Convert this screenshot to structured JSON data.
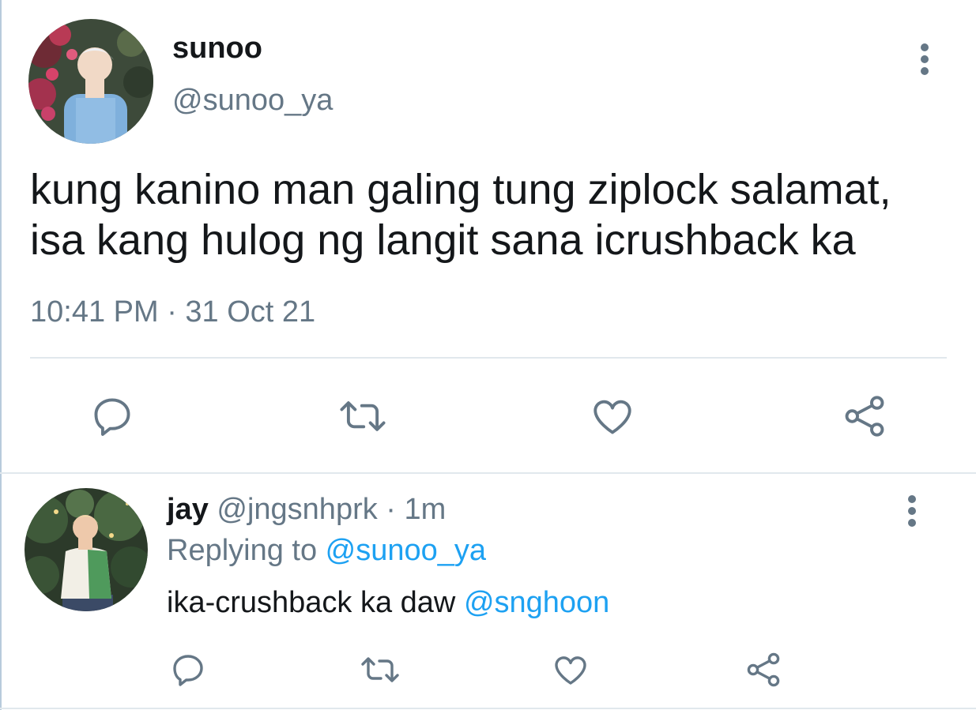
{
  "main_tweet": {
    "display_name": "sunoo",
    "handle": "@sunoo_ya",
    "text_line_1": "kung kanino man galing tung ziplock salamat,",
    "text_line_2": "isa kang hulog ng langit sana icrushback ka",
    "timestamp": "10:41 PM · 31 Oct 21",
    "actions": [
      "reply-icon",
      "retweet-icon",
      "like-icon",
      "share-icon"
    ]
  },
  "reply": {
    "display_name": "jay",
    "handle": "@jngsnhprk",
    "separator": " · ",
    "time": "1m",
    "replying_label": "Replying to ",
    "replying_to": "@sunoo_ya",
    "text": "ika-crushback ka daw ",
    "mention": "@snghoon",
    "actions": [
      "reply-icon",
      "retweet-icon",
      "like-icon",
      "share-icon"
    ]
  },
  "colors": {
    "text_primary": "#14171a",
    "text_secondary": "#657786",
    "link": "#1da1f2",
    "divider": "#e1e8ed"
  }
}
